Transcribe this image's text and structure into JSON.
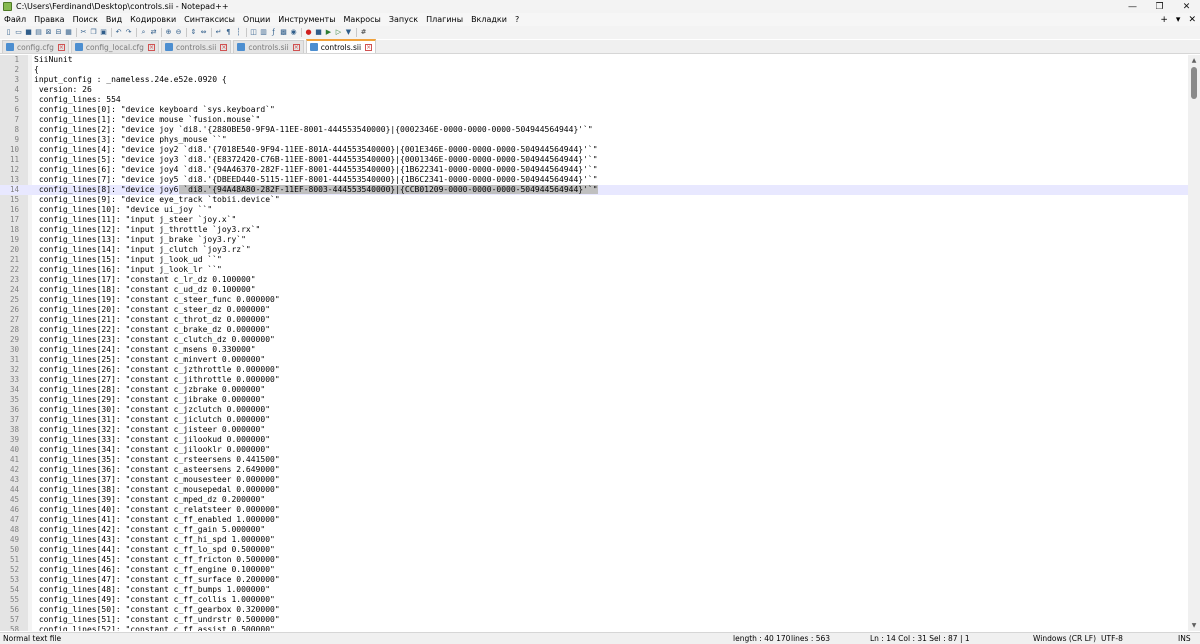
{
  "window": {
    "title": "C:\\Users\\Ferdinand\\Desktop\\controls.sii - Notepad++",
    "controls": {
      "minimize": "—",
      "maximize": "❐",
      "close": "✕"
    }
  },
  "menu": {
    "items": [
      "Файл",
      "Правка",
      "Поиск",
      "Вид",
      "Кодировки",
      "Синтаксисы",
      "Опции",
      "Инструменты",
      "Макросы",
      "Запуск",
      "Плагины",
      "Вкладки",
      "?"
    ],
    "right": {
      "add": "+",
      "dropdown": "▾",
      "close": "✕"
    }
  },
  "toolbar": {
    "icons": [
      "new-file-icon",
      "open-file-icon",
      "save-icon",
      "save-all-icon",
      "close-icon",
      "close-all-icon",
      "print-icon",
      "cut-icon",
      "copy-icon",
      "paste-icon",
      "undo-icon",
      "redo-icon",
      "find-icon",
      "replace-icon",
      "zoom-in-icon",
      "zoom-out-icon",
      "sync-vertical-icon",
      "sync-horizontal-icon",
      "word-wrap-icon",
      "show-all-chars-icon",
      "indent-guide-icon",
      "language-icon",
      "doc-map-icon",
      "function-list-icon",
      "folder-workspace-icon",
      "monitoring-icon",
      "record-macro-icon",
      "stop-macro-icon",
      "play-macro-icon",
      "run-macro-icon",
      "save-macro-icon",
      "spell-icon"
    ]
  },
  "tabs": [
    {
      "label": "config.cfg",
      "active": false
    },
    {
      "label": "config_local.cfg",
      "active": false
    },
    {
      "label": "controls.sii",
      "active": false
    },
    {
      "label": "controls.sii",
      "active": false
    },
    {
      "label": "controls.sii",
      "active": true
    }
  ],
  "editor": {
    "current_line": 14,
    "selection": {
      "line": 14,
      "prefix": " config_lines[8]: \"device joy6",
      "selected": " `di8.'{94A48A80-282F-11EF-8003-444553540000}|{CCB01209-0000-0000-0000-504944564944}'`\""
    },
    "lines": [
      {
        "n": "1",
        "text": "SiiNunit"
      },
      {
        "n": "2",
        "text": "{"
      },
      {
        "n": "3",
        "text": "input_config : _nameless.24e.e52e.0920 {"
      },
      {
        "n": "4",
        "text": " version: 26"
      },
      {
        "n": "5",
        "text": " config_lines: 554"
      },
      {
        "n": "6",
        "text": " config_lines[0]: \"device keyboard `sys.keyboard`\""
      },
      {
        "n": "7",
        "text": " config_lines[1]: \"device mouse `fusion.mouse`\""
      },
      {
        "n": "8",
        "text": " config_lines[2]: \"device joy `di8.'{2880BE50-9F9A-11EE-8001-444553540000}|{0002346E-0000-0000-0000-504944564944}'`\""
      },
      {
        "n": "9",
        "text": " config_lines[3]: \"device phys_mouse ``\""
      },
      {
        "n": "10",
        "text": " config_lines[4]: \"device joy2 `di8.'{7018E540-9F94-11EE-801A-444553540000}|{001E346E-0000-0000-0000-504944564944}'`\""
      },
      {
        "n": "11",
        "text": " config_lines[5]: \"device joy3 `di8.'{E8372420-C76B-11EE-8001-444553540000}|{0001346E-0000-0000-0000-504944564944}'`\""
      },
      {
        "n": "12",
        "text": " config_lines[6]: \"device joy4 `di8.'{94A46370-282F-11EF-8001-444553540000}|{1B622341-0000-0000-0000-504944564944}'`\""
      },
      {
        "n": "13",
        "text": " config_lines[7]: \"device joy5 `di8.'{DBEED440-5115-11EF-8001-444553540000}|{1B6C2341-0000-0000-0000-504944564944}'`\""
      },
      {
        "n": "14",
        "text": ""
      },
      {
        "n": "15",
        "text": " config_lines[9]: \"device eye_track `tobii.device`\""
      },
      {
        "n": "16",
        "text": " config_lines[10]: \"device ui_joy ``\""
      },
      {
        "n": "17",
        "text": " config_lines[11]: \"input j_steer `joy.x`\""
      },
      {
        "n": "18",
        "text": " config_lines[12]: \"input j_throttle `joy3.rx`\""
      },
      {
        "n": "19",
        "text": " config_lines[13]: \"input j_brake `joy3.ry`\""
      },
      {
        "n": "20",
        "text": " config_lines[14]: \"input j_clutch `joy3.rz`\""
      },
      {
        "n": "21",
        "text": " config_lines[15]: \"input j_look_ud ``\""
      },
      {
        "n": "22",
        "text": " config_lines[16]: \"input j_look_lr ``\""
      },
      {
        "n": "23",
        "text": " config_lines[17]: \"constant c_lr_dz 0.100000\""
      },
      {
        "n": "24",
        "text": " config_lines[18]: \"constant c_ud_dz 0.100000\""
      },
      {
        "n": "25",
        "text": " config_lines[19]: \"constant c_steer_func 0.000000\""
      },
      {
        "n": "26",
        "text": " config_lines[20]: \"constant c_steer_dz 0.000000\""
      },
      {
        "n": "27",
        "text": " config_lines[21]: \"constant c_throt_dz 0.000000\""
      },
      {
        "n": "28",
        "text": " config_lines[22]: \"constant c_brake_dz 0.000000\""
      },
      {
        "n": "29",
        "text": " config_lines[23]: \"constant c_clutch_dz 0.000000\""
      },
      {
        "n": "30",
        "text": " config_lines[24]: \"constant c_msens 0.330000\""
      },
      {
        "n": "31",
        "text": " config_lines[25]: \"constant c_minvert 0.000000\""
      },
      {
        "n": "32",
        "text": " config_lines[26]: \"constant c_jzthrottle 0.000000\""
      },
      {
        "n": "33",
        "text": " config_lines[27]: \"constant c_jithrottle 0.000000\""
      },
      {
        "n": "34",
        "text": " config_lines[28]: \"constant c_jzbrake 0.000000\""
      },
      {
        "n": "35",
        "text": " config_lines[29]: \"constant c_jibrake 0.000000\""
      },
      {
        "n": "36",
        "text": " config_lines[30]: \"constant c_jzclutch 0.000000\""
      },
      {
        "n": "37",
        "text": " config_lines[31]: \"constant c_jiclutch 0.000000\""
      },
      {
        "n": "38",
        "text": " config_lines[32]: \"constant c_jisteer 0.000000\""
      },
      {
        "n": "39",
        "text": " config_lines[33]: \"constant c_jilookud 0.000000\""
      },
      {
        "n": "40",
        "text": " config_lines[34]: \"constant c_jilooklr 0.000000\""
      },
      {
        "n": "41",
        "text": " config_lines[35]: \"constant c_rsteersens 0.441500\""
      },
      {
        "n": "42",
        "text": " config_lines[36]: \"constant c_asteersens 2.649000\""
      },
      {
        "n": "43",
        "text": " config_lines[37]: \"constant c_mousesteer 0.000000\""
      },
      {
        "n": "44",
        "text": " config_lines[38]: \"constant c_mousepedal 0.000000\""
      },
      {
        "n": "45",
        "text": " config_lines[39]: \"constant c_mped_dz 0.200000\""
      },
      {
        "n": "46",
        "text": " config_lines[40]: \"constant c_relatsteer 0.000000\""
      },
      {
        "n": "47",
        "text": " config_lines[41]: \"constant c_ff_enabled 1.000000\""
      },
      {
        "n": "48",
        "text": " config_lines[42]: \"constant c_ff_gain 5.000000\""
      },
      {
        "n": "49",
        "text": " config_lines[43]: \"constant c_ff_hi_spd 1.000000\""
      },
      {
        "n": "50",
        "text": " config_lines[44]: \"constant c_ff_lo_spd 0.500000\""
      },
      {
        "n": "51",
        "text": " config_lines[45]: \"constant c_ff_fricton 0.500000\""
      },
      {
        "n": "52",
        "text": " config_lines[46]: \"constant c_ff_engine 0.100000\""
      },
      {
        "n": "53",
        "text": " config_lines[47]: \"constant c_ff_surface 0.200000\""
      },
      {
        "n": "54",
        "text": " config_lines[48]: \"constant c_ff_bumps 1.000000\""
      },
      {
        "n": "55",
        "text": " config_lines[49]: \"constant c_ff_collis 1.000000\""
      },
      {
        "n": "56",
        "text": " config_lines[50]: \"constant c_ff_gearbox 0.320000\""
      },
      {
        "n": "57",
        "text": " config_lines[51]: \"constant c_ff_undrstr 0.500000\""
      },
      {
        "n": "58",
        "text": " config_lines[52]: \"constant c_ff_assist 0.500000\""
      }
    ]
  },
  "statusbar": {
    "file_type": "Normal text file",
    "length": "length : 40 170",
    "lines": "lines : 563",
    "position": "Ln : 14    Col : 31    Sel : 87 | 1",
    "eol": "Windows (CR LF)",
    "encoding": "UTF-8",
    "mode": "INS"
  }
}
